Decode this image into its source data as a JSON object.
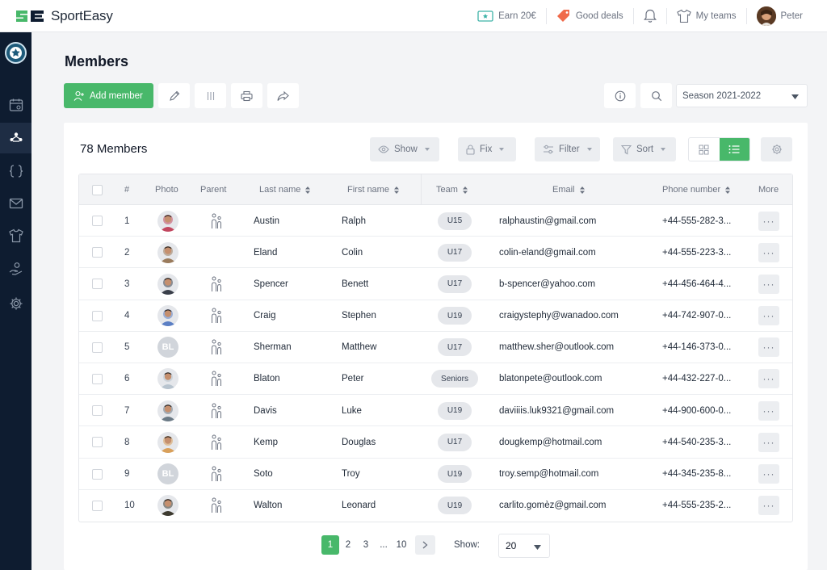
{
  "brand": {
    "name": "SportEasy",
    "accent": "#48b86a",
    "sidebar_bg": "#0e1c30"
  },
  "topbar": {
    "earn": "Earn 20€",
    "deals": "Good deals",
    "my_teams": "My teams",
    "user": "Peter"
  },
  "page": {
    "title": "Members"
  },
  "toolbar": {
    "add_member": "Add member"
  },
  "season": {
    "value": "Season 2021-2022"
  },
  "card": {
    "title": "78 Members",
    "show": "Show",
    "fix": "Fix",
    "filter": "Filter",
    "sort": "Sort"
  },
  "table": {
    "headers": {
      "num": "#",
      "photo": "Photo",
      "parent": "Parent",
      "last": "Last name",
      "first": "First name",
      "team": "Team",
      "email": "Email",
      "phone": "Phone number",
      "more": "More"
    },
    "rows": [
      {
        "num": "1",
        "initials": "",
        "avatar_color": "#c2475f",
        "parent": true,
        "last": "Austin",
        "first": "Ralph",
        "team": "U15",
        "email": "ralphaustin@gmail.com",
        "phone": "+44-555-282-3..."
      },
      {
        "num": "2",
        "initials": "",
        "avatar_color": "#9a7b5c",
        "parent": false,
        "last": "Eland",
        "first": "Colin",
        "team": "U17",
        "email": "colin-eland@gmail.com",
        "phone": "+44-555-223-3..."
      },
      {
        "num": "3",
        "initials": "",
        "avatar_color": "#3a3f4a",
        "parent": true,
        "last": "Spencer",
        "first": "Benett",
        "team": "U17",
        "email": "b-spencer@yahoo.com",
        "phone": "+44-456-464-4..."
      },
      {
        "num": "4",
        "initials": "",
        "avatar_color": "#5b7fc4",
        "parent": true,
        "last": "Craig",
        "first": "Stephen",
        "team": "U19",
        "email": "craigystephy@wanadoo.com",
        "phone": "+44-742-907-0..."
      },
      {
        "num": "5",
        "initials": "BL",
        "avatar_color": "#d1d5db",
        "parent": true,
        "last": "Sherman",
        "first": "Matthew",
        "team": "U17",
        "email": "matthew.sher@outlook.com",
        "phone": "+44-146-373-0..."
      },
      {
        "num": "6",
        "initials": "",
        "avatar_color": "#b8c4cf",
        "parent": true,
        "last": "Blaton",
        "first": "Peter",
        "team": "Seniors",
        "email": "blatonpete@outlook.com",
        "phone": "+44-432-227-0..."
      },
      {
        "num": "7",
        "initials": "",
        "avatar_color": "#6b7a86",
        "parent": true,
        "last": "Davis",
        "first": "Luke",
        "team": "U19",
        "email": "daviiiis.luk9321@gmail.com",
        "phone": "+44-900-600-0..."
      },
      {
        "num": "8",
        "initials": "",
        "avatar_color": "#d9a05b",
        "parent": true,
        "last": "Kemp",
        "first": "Douglas",
        "team": "U17",
        "email": "dougkemp@hotmail.com",
        "phone": "+44-540-235-3..."
      },
      {
        "num": "9",
        "initials": "BL",
        "avatar_color": "#d1d5db",
        "parent": true,
        "last": "Soto",
        "first": "Troy",
        "team": "U19",
        "email": "troy.semp@hotmail.com",
        "phone": "+44-345-235-8..."
      },
      {
        "num": "10",
        "initials": "",
        "avatar_color": "#3d3a2f",
        "parent": true,
        "last": "Walton",
        "first": "Leonard",
        "team": "U19",
        "email": "carlito.gomèz@gmail.com",
        "phone": "+44-555-235-2..."
      }
    ]
  },
  "pagination": {
    "pages": [
      "1",
      "2",
      "3",
      "...",
      "10"
    ],
    "show_label": "Show:",
    "show_value": "20"
  }
}
